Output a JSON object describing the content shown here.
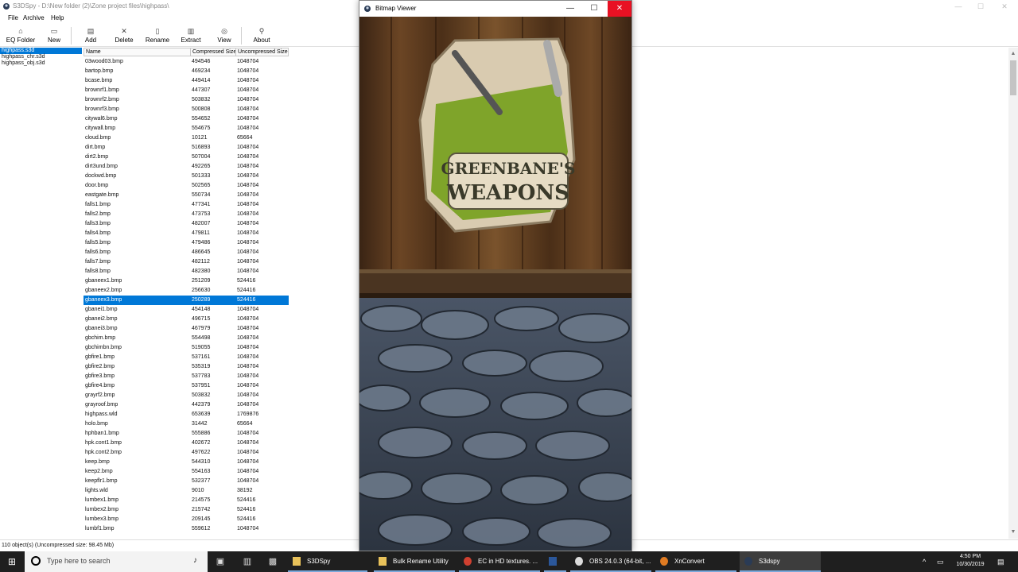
{
  "window": {
    "title": "S3DSpy - D:\\New folder (2)\\Zone project files\\highpass\\",
    "minimize": "—",
    "maximize": "☐",
    "close": "✕"
  },
  "menu": [
    "File",
    "Archive",
    "Help"
  ],
  "toolbar": {
    "eq_folder": "EQ Folder",
    "new": "New",
    "add": "Add",
    "delete": "Delete",
    "rename": "Rename",
    "extract": "Extract",
    "view": "View",
    "about": "About"
  },
  "archives": [
    {
      "name": "highpass.s3d",
      "selected": true
    },
    {
      "name": "highpass_chr.s3d",
      "selected": false
    },
    {
      "name": "highpass_obj.s3d",
      "selected": false
    }
  ],
  "table": {
    "headers": [
      "Name",
      "Compressed Size",
      "Uncompressed Size"
    ],
    "rows": [
      [
        "03wood03.bmp",
        "494546",
        "1048704"
      ],
      [
        "bartop.bmp",
        "469234",
        "1048704"
      ],
      [
        "bcase.bmp",
        "449414",
        "1048704"
      ],
      [
        "brownrf1.bmp",
        "447307",
        "1048704"
      ],
      [
        "brownrf2.bmp",
        "503832",
        "1048704"
      ],
      [
        "brownrf3.bmp",
        "500808",
        "1048704"
      ],
      [
        "citywal6.bmp",
        "554652",
        "1048704"
      ],
      [
        "citywall.bmp",
        "554675",
        "1048704"
      ],
      [
        "cloud.bmp",
        "10121",
        "65664"
      ],
      [
        "dirt.bmp",
        "516893",
        "1048704"
      ],
      [
        "dirt2.bmp",
        "507004",
        "1048704"
      ],
      [
        "dirt3und.bmp",
        "492265",
        "1048704"
      ],
      [
        "dockwd.bmp",
        "501333",
        "1048704"
      ],
      [
        "door.bmp",
        "502565",
        "1048704"
      ],
      [
        "eastgate.bmp",
        "550734",
        "1048704"
      ],
      [
        "falls1.bmp",
        "477341",
        "1048704"
      ],
      [
        "falls2.bmp",
        "473753",
        "1048704"
      ],
      [
        "falls3.bmp",
        "482007",
        "1048704"
      ],
      [
        "falls4.bmp",
        "479811",
        "1048704"
      ],
      [
        "falls5.bmp",
        "479486",
        "1048704"
      ],
      [
        "falls6.bmp",
        "486645",
        "1048704"
      ],
      [
        "falls7.bmp",
        "482112",
        "1048704"
      ],
      [
        "falls8.bmp",
        "482380",
        "1048704"
      ],
      [
        "gbaneex1.bmp",
        "251209",
        "524416"
      ],
      [
        "gbaneex2.bmp",
        "256630",
        "524416"
      ],
      [
        "gbaneex3.bmp",
        "250289",
        "524416"
      ],
      [
        "gbanei1.bmp",
        "454148",
        "1048704"
      ],
      [
        "gbanei2.bmp",
        "496715",
        "1048704"
      ],
      [
        "gbanei3.bmp",
        "467979",
        "1048704"
      ],
      [
        "gbchim.bmp",
        "554498",
        "1048704"
      ],
      [
        "gbchimbn.bmp",
        "519055",
        "1048704"
      ],
      [
        "gbfire1.bmp",
        "537161",
        "1048704"
      ],
      [
        "gbfire2.bmp",
        "535319",
        "1048704"
      ],
      [
        "gbfire3.bmp",
        "537783",
        "1048704"
      ],
      [
        "gbfire4.bmp",
        "537951",
        "1048704"
      ],
      [
        "grayrf2.bmp",
        "503832",
        "1048704"
      ],
      [
        "grayroof.bmp",
        "442379",
        "1048704"
      ],
      [
        "highpass.wld",
        "653639",
        "1769876"
      ],
      [
        "holo.bmp",
        "31442",
        "65664"
      ],
      [
        "hphban1.bmp",
        "555886",
        "1048704"
      ],
      [
        "hpk.cont1.bmp",
        "402672",
        "1048704"
      ],
      [
        "hpk.cont2.bmp",
        "497622",
        "1048704"
      ],
      [
        "keep.bmp",
        "544310",
        "1048704"
      ],
      [
        "keep2.bmp",
        "554163",
        "1048704"
      ],
      [
        "keepflr1.bmp",
        "532377",
        "1048704"
      ],
      [
        "lights.wld",
        "9010",
        "38192"
      ],
      [
        "lumbex1.bmp",
        "214575",
        "524416"
      ],
      [
        "lumbex2.bmp",
        "215742",
        "524416"
      ],
      [
        "lumbex3.bmp",
        "209145",
        "524416"
      ],
      [
        "lumbf1.bmp",
        "559612",
        "1048704"
      ]
    ],
    "selected_index": 25
  },
  "status": "110 object(s) (Uncompressed size: 98.45 Mb)",
  "viewer": {
    "title": "Bitmap Viewer",
    "minimize": "—",
    "maximize": "☐",
    "close": "✕",
    "sign_line1": "GREENBANE'S",
    "sign_line2": "WEAPONS"
  },
  "taskbar": {
    "search_placeholder": "Type here to search",
    "apps": [
      {
        "label": "S3DSpy",
        "open": true,
        "active": false
      },
      {
        "label": "Bulk Rename Utility",
        "open": true,
        "active": false
      },
      {
        "label": "EC in HD textures. ...",
        "open": true,
        "active": false
      },
      {
        "label": "",
        "open": true,
        "active": false
      },
      {
        "label": "OBS 24.0.3 (64-bit, ...",
        "open": true,
        "active": false
      },
      {
        "label": "XnConvert",
        "open": true,
        "active": false
      },
      {
        "label": "S3dspy",
        "open": true,
        "active": true
      }
    ],
    "time": "4:50 PM",
    "date": "10/30/2019"
  }
}
